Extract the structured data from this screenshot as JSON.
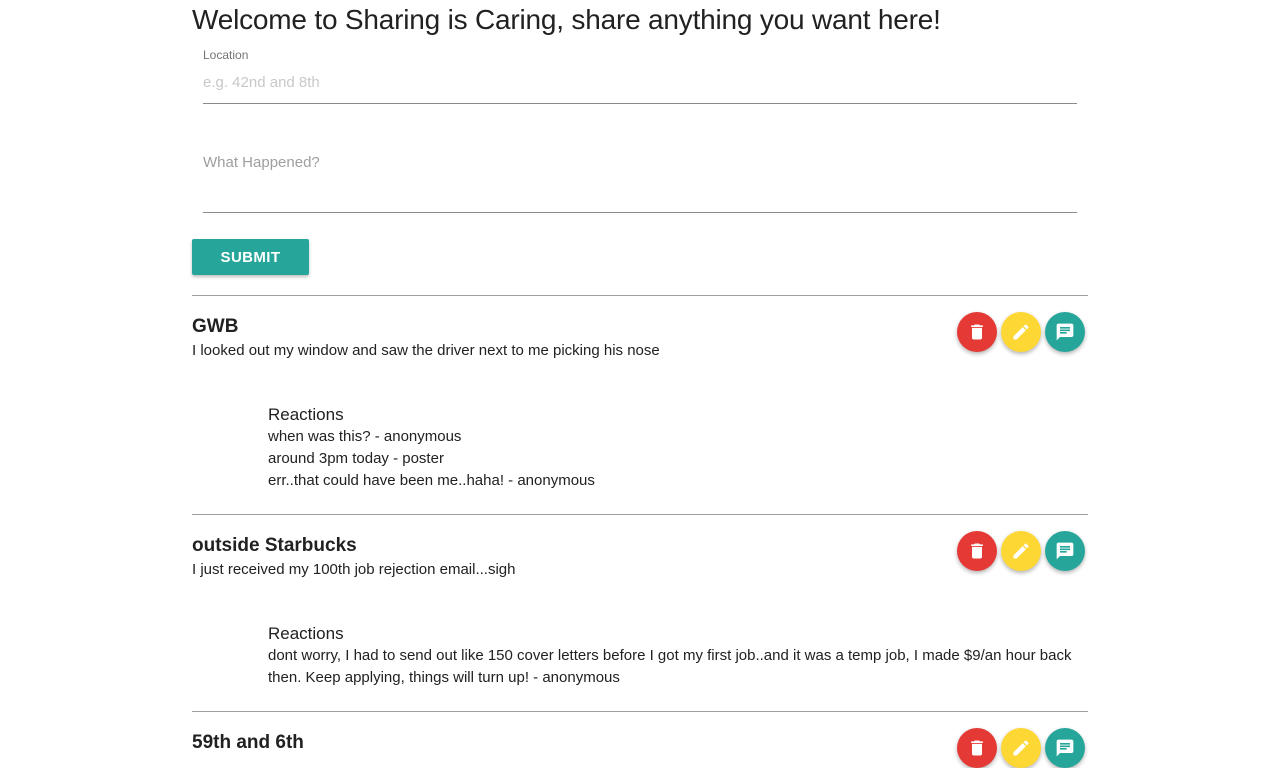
{
  "page": {
    "title": "Welcome to Sharing is Caring, share anything you want here!"
  },
  "form": {
    "location_label": "Location",
    "location_placeholder": "e.g. 42nd and 8th",
    "what_placeholder": "What Happened?",
    "submit_label": "SUBMIT"
  },
  "colors": {
    "accent": "#26a69a",
    "delete": "#e53935",
    "edit": "#fdd835"
  },
  "icons": {
    "delete": "trash-icon",
    "edit": "pencil-icon",
    "comment": "comment-icon"
  },
  "posts": [
    {
      "location": "GWB",
      "text": "I looked out my window and saw the driver next to me picking his nose",
      "reactions_title": "Reactions",
      "reactions": [
        "when was this? - anonymous",
        "around 3pm today - poster",
        "err..that could have been me..haha! - anonymous"
      ]
    },
    {
      "location": "outside Starbucks",
      "text": "I just received my 100th job rejection email...sigh",
      "reactions_title": "Reactions",
      "reactions": [
        "dont worry, I had to send out like 150 cover letters before I got my first job..and it was a temp job, I made $9/an hour back then. Keep applying, things will turn up! - anonymous"
      ]
    },
    {
      "location": "59th and 6th"
    }
  ]
}
